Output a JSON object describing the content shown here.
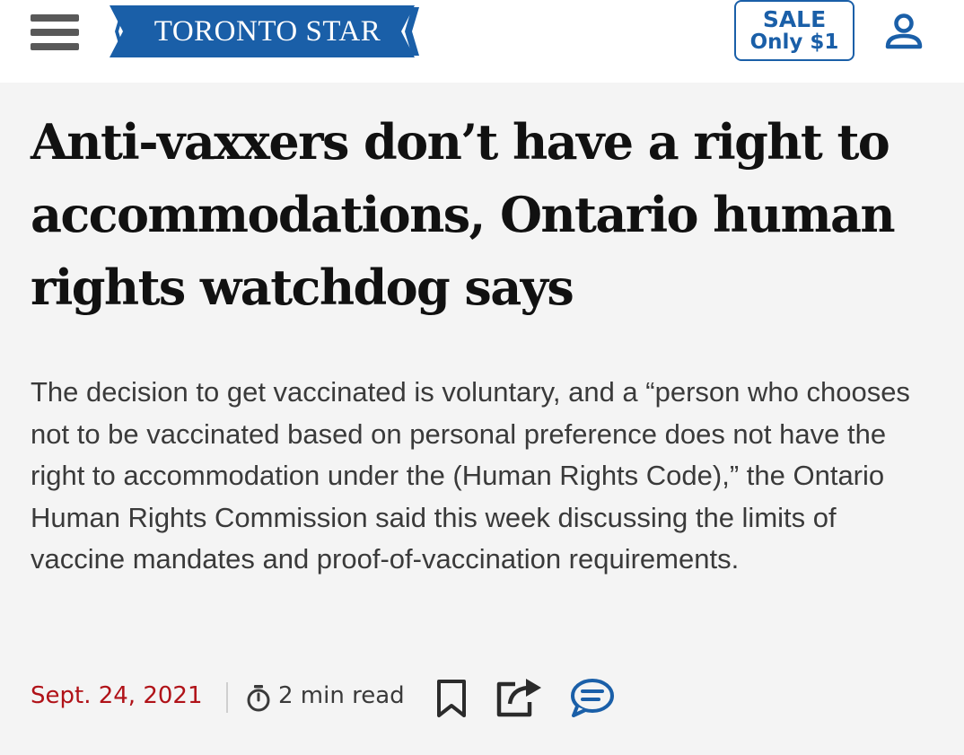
{
  "header": {
    "logo_text": "TORONTO STAR",
    "sale_line1": "SALE",
    "sale_line2": "Only $1",
    "icons": [
      "menu-icon",
      "user-icon"
    ]
  },
  "article": {
    "headline": "Anti-vaxxers don’t have a right to accommodations, Ontario human rights watchdog says",
    "deck": "The decision to get vaccinated is voluntary, and a “person who chooses not to be vaccinated based on personal preference does not have the right to accommodation under the (Human Rights Code),” the Ontario Human Rights Commission said this week discussing the limits of vaccine mandates and proof-of-vaccination requirements.",
    "date": "Sept. 24, 2021",
    "read_time": "2 min read",
    "action_icons": [
      "bookmark-icon",
      "share-icon",
      "comment-icon"
    ]
  },
  "colors": {
    "brand_blue": "#1a5fa8",
    "date_red": "#b01218",
    "menu_gray": "#595959"
  }
}
